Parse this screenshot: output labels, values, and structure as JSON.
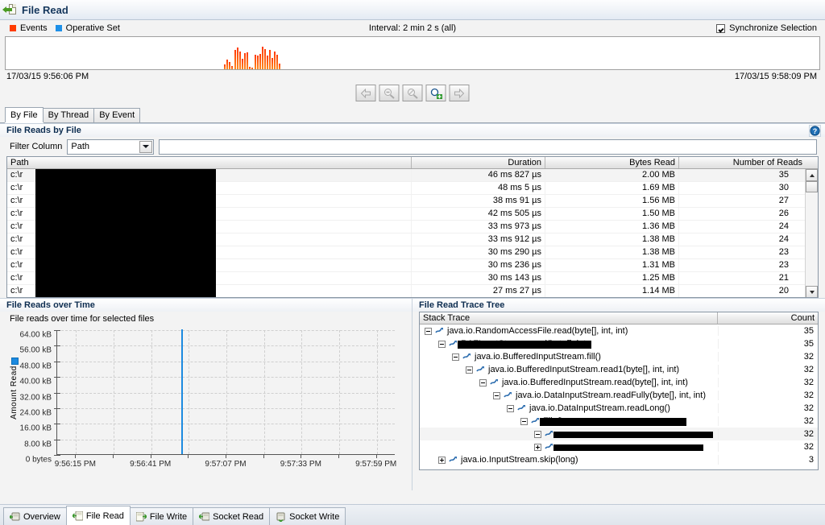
{
  "window": {
    "title": "File Read",
    "title_icon": "file-read-icon"
  },
  "toolbar": {
    "legend": [
      {
        "label": "Events",
        "color": "#ff3c00",
        "icon": "events-swatch"
      },
      {
        "label": "Operative Set",
        "color": "#1e90e8",
        "icon": "operative-set-swatch"
      }
    ],
    "interval": "Interval: 2 min 2 s (all)",
    "sync_selection": {
      "label": "Synchronize Selection",
      "checked": true
    },
    "time_start": "17/03/15 9:56:06 PM",
    "time_end": "17/03/15 9:58:09 PM",
    "nav_buttons": [
      {
        "name": "back-arrow-icon",
        "enabled": false
      },
      {
        "name": "zoom-out-icon",
        "enabled": false
      },
      {
        "name": "zoom-reset-icon",
        "enabled": false
      },
      {
        "name": "zoom-in-icon",
        "enabled": true
      },
      {
        "name": "forward-arrow-icon",
        "enabled": false
      }
    ]
  },
  "view_tabs": [
    {
      "label": "By File",
      "selected": true
    },
    {
      "label": "By Thread",
      "selected": false
    },
    {
      "label": "By Event",
      "selected": false
    }
  ],
  "reads_by_file": {
    "section_title": "File Reads by File",
    "help_icon": "help-icon",
    "filter": {
      "label": "Filter Column",
      "selected_column": "Path",
      "options": [
        "Path",
        "Duration",
        "Bytes Read",
        "Number of Reads"
      ],
      "text_value": "",
      "text_placeholder": ""
    },
    "columns": [
      "Path",
      "Duration",
      "Bytes Read",
      "Number of Reads"
    ],
    "rows": [
      {
        "path": "c:\\r",
        "duration": "46 ms 827 µs",
        "bytes": "2.00 MB",
        "reads": "35"
      },
      {
        "path": "c:\\r",
        "duration": "48 ms 5 µs",
        "bytes": "1.69 MB",
        "reads": "30"
      },
      {
        "path": "c:\\r",
        "duration": "38 ms 91 µs",
        "bytes": "1.56 MB",
        "reads": "27"
      },
      {
        "path": "c:\\r",
        "duration": "42 ms 505 µs",
        "bytes": "1.50 MB",
        "reads": "26"
      },
      {
        "path": "c:\\r",
        "duration": "33 ms 973 µs",
        "bytes": "1.36 MB",
        "reads": "24"
      },
      {
        "path": "c:\\r",
        "duration": "33 ms 912 µs",
        "bytes": "1.38 MB",
        "reads": "24"
      },
      {
        "path": "c:\\r",
        "duration": "30 ms 290 µs",
        "bytes": "1.38 MB",
        "reads": "23"
      },
      {
        "path": "c:\\r",
        "duration": "30 ms 236 µs",
        "bytes": "1.31 MB",
        "reads": "23"
      },
      {
        "path": "c:\\r",
        "duration": "30 ms 143 µs",
        "bytes": "1.25 MB",
        "reads": "21"
      },
      {
        "path": "c:\\r",
        "duration": "27 ms 27 µs",
        "bytes": "1.14 MB",
        "reads": "20"
      }
    ]
  },
  "reads_over_time": {
    "section_title": "File Reads over Time",
    "subtitle": "File reads over time for selected files"
  },
  "trace_tree": {
    "section_title": "File Read Trace Tree",
    "columns": [
      "Stack Trace",
      "Count"
    ],
    "rows": [
      {
        "depth": 0,
        "expander": "minus",
        "text": "java.io.RandomAccessFile.read(byte[], int, int)",
        "count": "35",
        "redacted": false
      },
      {
        "depth": 1,
        "expander": "minus",
        "text": "RAFInputStream.read(byte[], int,",
        "count": "35",
        "redacted": true,
        "redact_w": 166
      },
      {
        "depth": 2,
        "expander": "minus",
        "text": "java.io.BufferedInputStream.fill()",
        "count": "32",
        "redacted": false
      },
      {
        "depth": 3,
        "expander": "minus",
        "text": "java.io.BufferedInputStream.read1(byte[], int, int)",
        "count": "32",
        "redacted": false
      },
      {
        "depth": 4,
        "expander": "minus",
        "text": "java.io.BufferedInputStream.read(byte[], int, int)",
        "count": "32",
        "redacted": false
      },
      {
        "depth": 5,
        "expander": "minus",
        "text": "java.io.DataInputStream.readFully(byte[], int, int)",
        "count": "32",
        "redacted": false
      },
      {
        "depth": 6,
        "expander": "minus",
        "text": "java.io.DataInputStream.readLong()",
        "count": "32",
        "redacted": false
      },
      {
        "depth": 7,
        "expander": "minus",
        "text": "File$.op",
        "count": "32",
        "redacted": true,
        "redact_w": 182
      },
      {
        "depth": 8,
        "expander": "minus",
        "text": "",
        "count": "32",
        "redacted": true,
        "redact_w": 198
      },
      {
        "depth": 8,
        "expander": "plus",
        "text": "",
        "count": "32",
        "redacted": true,
        "redact_w": 186
      },
      {
        "depth": 1,
        "expander": "plus",
        "text": "java.io.InputStream.skip(long)",
        "count": "3",
        "redacted": false
      }
    ]
  },
  "bottom_tabs": [
    {
      "label": "Overview",
      "icon": "disk-overview-icon",
      "selected": false
    },
    {
      "label": "File Read",
      "icon": "disk-read-icon",
      "selected": true
    },
    {
      "label": "File Write",
      "icon": "disk-write-icon",
      "selected": false
    },
    {
      "label": "Socket Read",
      "icon": "socket-read-icon",
      "selected": false
    },
    {
      "label": "Socket Write",
      "icon": "socket-write-icon",
      "selected": false
    }
  ],
  "colors": {
    "events": "#ff3c00",
    "operative_set": "#1e90e8",
    "series": "#1c8ae0",
    "title_text": "#15375c"
  },
  "chart_data": {
    "type": "bar",
    "title": "File Reads over Time",
    "subtitle": "File reads over time for selected files",
    "xlabel": "",
    "ylabel": "Amount Read",
    "ylim": [
      0,
      68000
    ],
    "ytick_labels": [
      "64.00 kB",
      "56.00 kB",
      "48.00 kB",
      "40.00 kB",
      "32.00 kB",
      "24.00 kB",
      "16.00 kB",
      "8.00 kB",
      "0 bytes"
    ],
    "ytick_values": [
      65536,
      57344,
      49152,
      40960,
      32768,
      24576,
      16384,
      8192,
      0
    ],
    "xtick_labels": [
      "9:56:15 PM",
      "9:56:41 PM",
      "9:57:07 PM",
      "9:57:33 PM",
      "9:57:59 PM"
    ],
    "grid": true,
    "legend_position": "left-axis",
    "series": [
      {
        "name": "Amount Read",
        "color": "#1c8ae0",
        "x": [
          "9:56:41 PM"
        ],
        "values": [
          65536
        ],
        "value_labels": [
          "64.00 kB"
        ]
      }
    ],
    "bars": [
      {
        "x_frac": 0.366,
        "value": 65536
      }
    ]
  },
  "overview_timeline": {
    "type": "bar",
    "color": "#ff3c00",
    "bars": [
      {
        "x": 278,
        "h": 6
      },
      {
        "x": 281,
        "h": 12
      },
      {
        "x": 284,
        "h": 9
      },
      {
        "x": 287,
        "h": 4
      },
      {
        "x": 291,
        "h": 24
      },
      {
        "x": 294,
        "h": 27
      },
      {
        "x": 297,
        "h": 22
      },
      {
        "x": 300,
        "h": 13
      },
      {
        "x": 303,
        "h": 20
      },
      {
        "x": 306,
        "h": 21
      },
      {
        "x": 309,
        "h": 3
      },
      {
        "x": 312,
        "h": 2
      },
      {
        "x": 316,
        "h": 18
      },
      {
        "x": 319,
        "h": 17
      },
      {
        "x": 322,
        "h": 19
      },
      {
        "x": 325,
        "h": 28
      },
      {
        "x": 328,
        "h": 25
      },
      {
        "x": 331,
        "h": 17
      },
      {
        "x": 334,
        "h": 24
      },
      {
        "x": 337,
        "h": 14
      },
      {
        "x": 340,
        "h": 22
      },
      {
        "x": 343,
        "h": 18
      },
      {
        "x": 346,
        "h": 7
      }
    ]
  }
}
